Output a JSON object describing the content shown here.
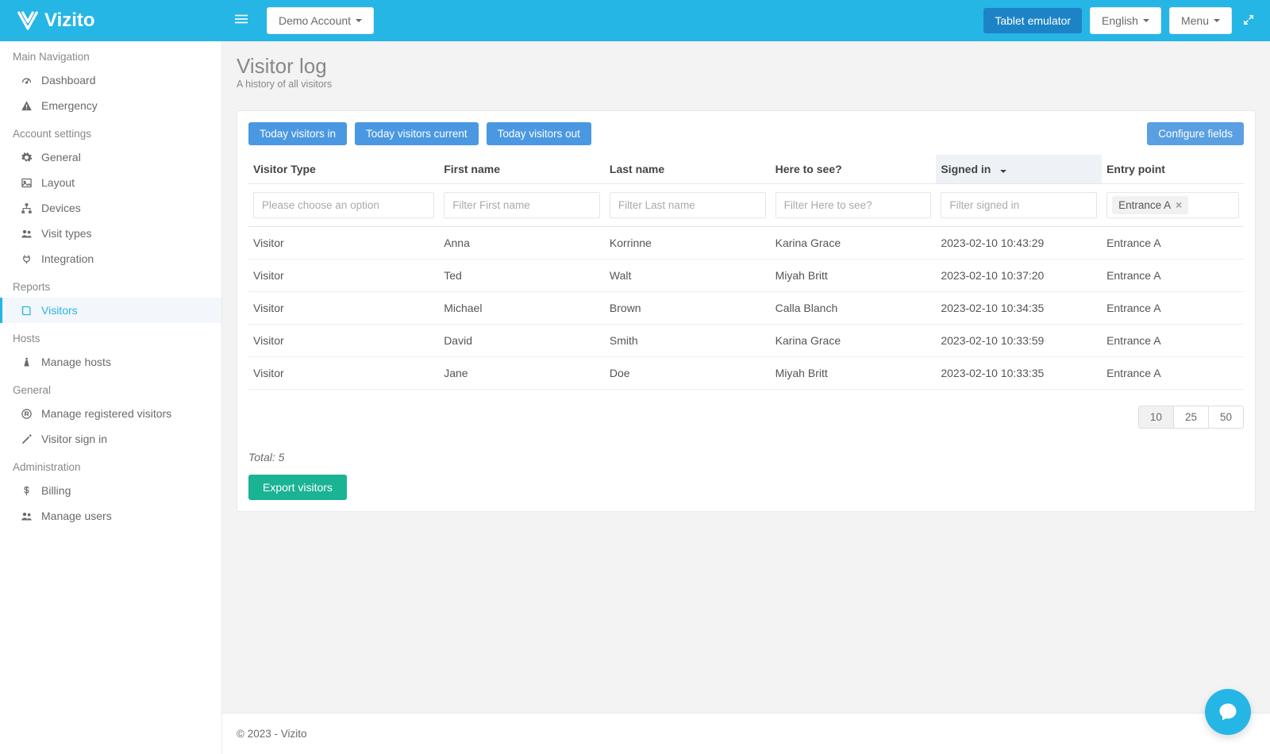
{
  "header": {
    "account_label": "Demo Account",
    "emulator_label": "Tablet emulator",
    "language_label": "English",
    "menu_label": "Menu"
  },
  "sidebar": {
    "sections": {
      "main_nav": "Main Navigation",
      "account_settings": "Account settings",
      "reports": "Reports",
      "hosts": "Hosts",
      "general": "General",
      "administration": "Administration"
    },
    "items": {
      "dashboard": "Dashboard",
      "emergency": "Emergency",
      "general": "General",
      "layout": "Layout",
      "devices": "Devices",
      "visit_types": "Visit types",
      "integration": "Integration",
      "visitors": "Visitors",
      "manage_hosts": "Manage hosts",
      "manage_registered": "Manage registered visitors",
      "visitor_sign_in": "Visitor sign in",
      "billing": "Billing",
      "manage_users": "Manage users"
    }
  },
  "page": {
    "title": "Visitor log",
    "subtitle": "A history of all visitors"
  },
  "toolbar": {
    "today_in": "Today visitors in",
    "today_current": "Today visitors current",
    "today_out": "Today visitors out",
    "configure": "Configure fields"
  },
  "table": {
    "headers": {
      "type": "Visitor Type",
      "first": "First name",
      "last": "Last name",
      "host": "Here to see?",
      "signed": "Signed in",
      "entry": "Entry point"
    },
    "placeholders": {
      "type": "Please choose an option",
      "first": "Filter First name",
      "last": "Filter Last name",
      "host": "Filter Here to see?",
      "signed": "Filter signed in"
    },
    "entry_filter_tag": "Entrance A",
    "rows": [
      {
        "type": "Visitor",
        "first": "Anna",
        "last": "Korrinne",
        "host": "Karina Grace",
        "signed": "2023-02-10 10:43:29",
        "entry": "Entrance A"
      },
      {
        "type": "Visitor",
        "first": "Ted",
        "last": "Walt",
        "host": "Miyah Britt",
        "signed": "2023-02-10 10:37:20",
        "entry": "Entrance A"
      },
      {
        "type": "Visitor",
        "first": "Michael",
        "last": "Brown",
        "host": "Calla Blanch",
        "signed": "2023-02-10 10:34:35",
        "entry": "Entrance A"
      },
      {
        "type": "Visitor",
        "first": "David",
        "last": "Smith",
        "host": "Karina Grace",
        "signed": "2023-02-10 10:33:59",
        "entry": "Entrance A"
      },
      {
        "type": "Visitor",
        "first": "Jane",
        "last": "Doe",
        "host": "Miyah Britt",
        "signed": "2023-02-10 10:33:35",
        "entry": "Entrance A"
      }
    ]
  },
  "page_sizes": [
    "10",
    "25",
    "50"
  ],
  "total_label": "Total: 5",
  "export_label": "Export visitors",
  "footer": "© 2023 - Vizito"
}
